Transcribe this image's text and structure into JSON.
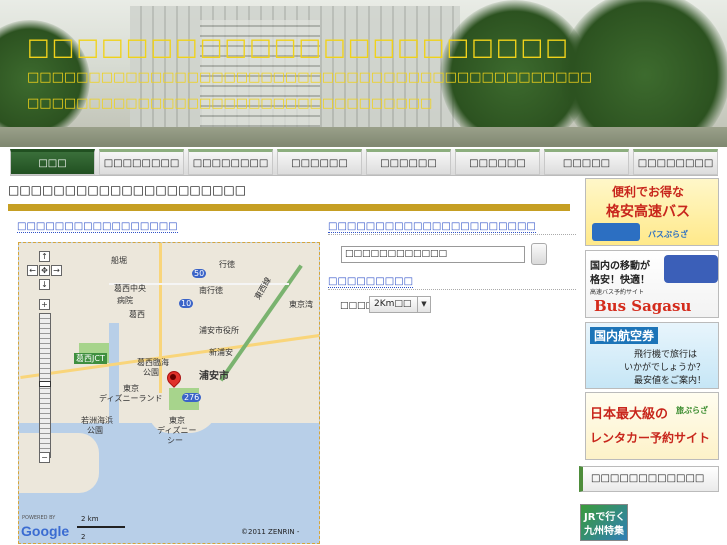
{
  "header": {
    "title": "□□□□□□□□□□□□□□□□□□□□□□",
    "description_line1": "□□□□□□□□□□□□□□□□□□□□□□□□□□□□□□□□□□□□□□□□□□□□□□",
    "description_line2": "□□□□□□□□□□□□□□□□□□□□□□□□□□□□□□□□□"
  },
  "nav": {
    "items": [
      {
        "label": "□□□",
        "active": true
      },
      {
        "label": "□□□□□□□□",
        "active": false
      },
      {
        "label": "□□□□□□□□",
        "active": false
      },
      {
        "label": "□□□□□□",
        "active": false
      },
      {
        "label": "□□□□□□",
        "active": false
      },
      {
        "label": "□□□□□□",
        "active": false
      },
      {
        "label": "□□□□□",
        "active": false
      },
      {
        "label": "□□□□□□□□",
        "active": false
      }
    ]
  },
  "main": {
    "title": "□□□□□□□□□□□□□□□□□□□□□",
    "map_heading": "□□□□□□□□□□□□□□□□□",
    "map": {
      "labels": [
        "船堀",
        "行徳",
        "葛西中央",
        "病院",
        "南行徳",
        "東西線",
        "東京湾",
        "葛西",
        "浦安市役所",
        "新浦安",
        "浦安市",
        "葛西臨海",
        "公園",
        "葛西JCT",
        "東京",
        "ディズニーランド",
        "東京",
        "ディズニー",
        "シー",
        "若洲海浜",
        "公園",
        "276",
        "50",
        "10"
      ],
      "powered_by": "POWERED BY",
      "google": "Google",
      "scale_top": "2 km",
      "scale_bottom": "2",
      "copyright": "©2011 ZENRIN -"
    }
  },
  "right_panel": {
    "search_heading": "□□□□□□□□□□□□□□□□□□□□□□",
    "search_value": "□□□□□□□□□□□□",
    "radius_heading": "□□□□□□□□□",
    "radius_label": "□□□□",
    "radius_selected": "2Km□□"
  },
  "sidebar": {
    "ad1": {
      "line1": "便利でお得な",
      "line2": "格安高速バス",
      "small": "バスぷらざ"
    },
    "ad2": {
      "line1": "国内の移動が",
      "line2": "格安！快適！",
      "small": "高速バス予約サイト",
      "brand": "Bus Sagasu"
    },
    "ad3": {
      "line1": "国内航空券",
      "line2": "飛行機で旅行は",
      "line3": "いかがでしょうか？",
      "line4": "最安値をご案内！"
    },
    "ad4": {
      "line1": "日本最大級の",
      "line2": "旅ぷらざ",
      "line3": "レンタカー予約サイト"
    },
    "box_label": "□□□□□□□□□□□□",
    "ad5": {
      "line1": "JRで行く",
      "line2": "九州特集"
    }
  }
}
